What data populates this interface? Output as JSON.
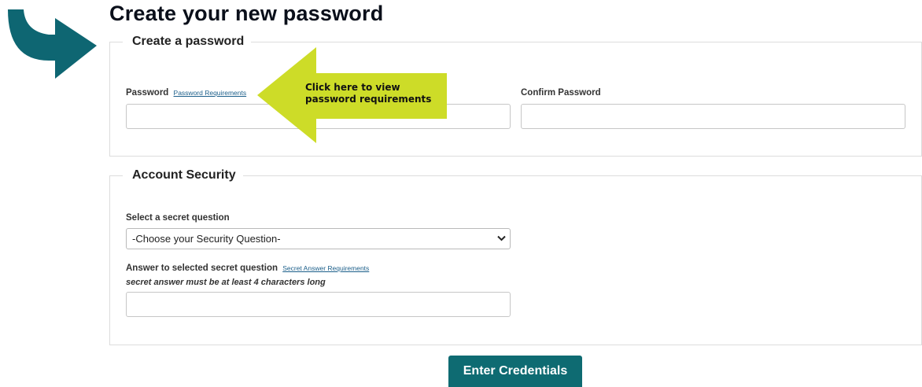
{
  "page": {
    "title": "Create your new password"
  },
  "password_section": {
    "legend": "Create a password",
    "password_label": "Password",
    "password_requirements_link": "Password Requirements",
    "password_value": "",
    "confirm_label": "Confirm Password",
    "confirm_value": ""
  },
  "security_section": {
    "legend": "Account Security",
    "question_label": "Select a secret question",
    "question_selected": "-Choose your Security Question-",
    "answer_label": "Answer to selected secret question",
    "answer_requirements_link": "Secret Answer Requirements",
    "answer_hint": "secret answer must be at least 4 characters long",
    "answer_value": ""
  },
  "submit": {
    "label": "Enter Credentials"
  },
  "annotation": {
    "callout_line1": "Click here to view",
    "callout_line2": "password requirements"
  },
  "colors": {
    "accent": "#0e6b72",
    "pointer_arrow": "#0e6672",
    "callout_arrow": "#cddc28",
    "link": "#1c5f8a",
    "border": "#dcdcdc"
  },
  "icons": {
    "pointer": "teal-curved-arrow-icon",
    "callout": "yellow-left-arrow-icon",
    "select_caret": "chevron-down-icon"
  }
}
